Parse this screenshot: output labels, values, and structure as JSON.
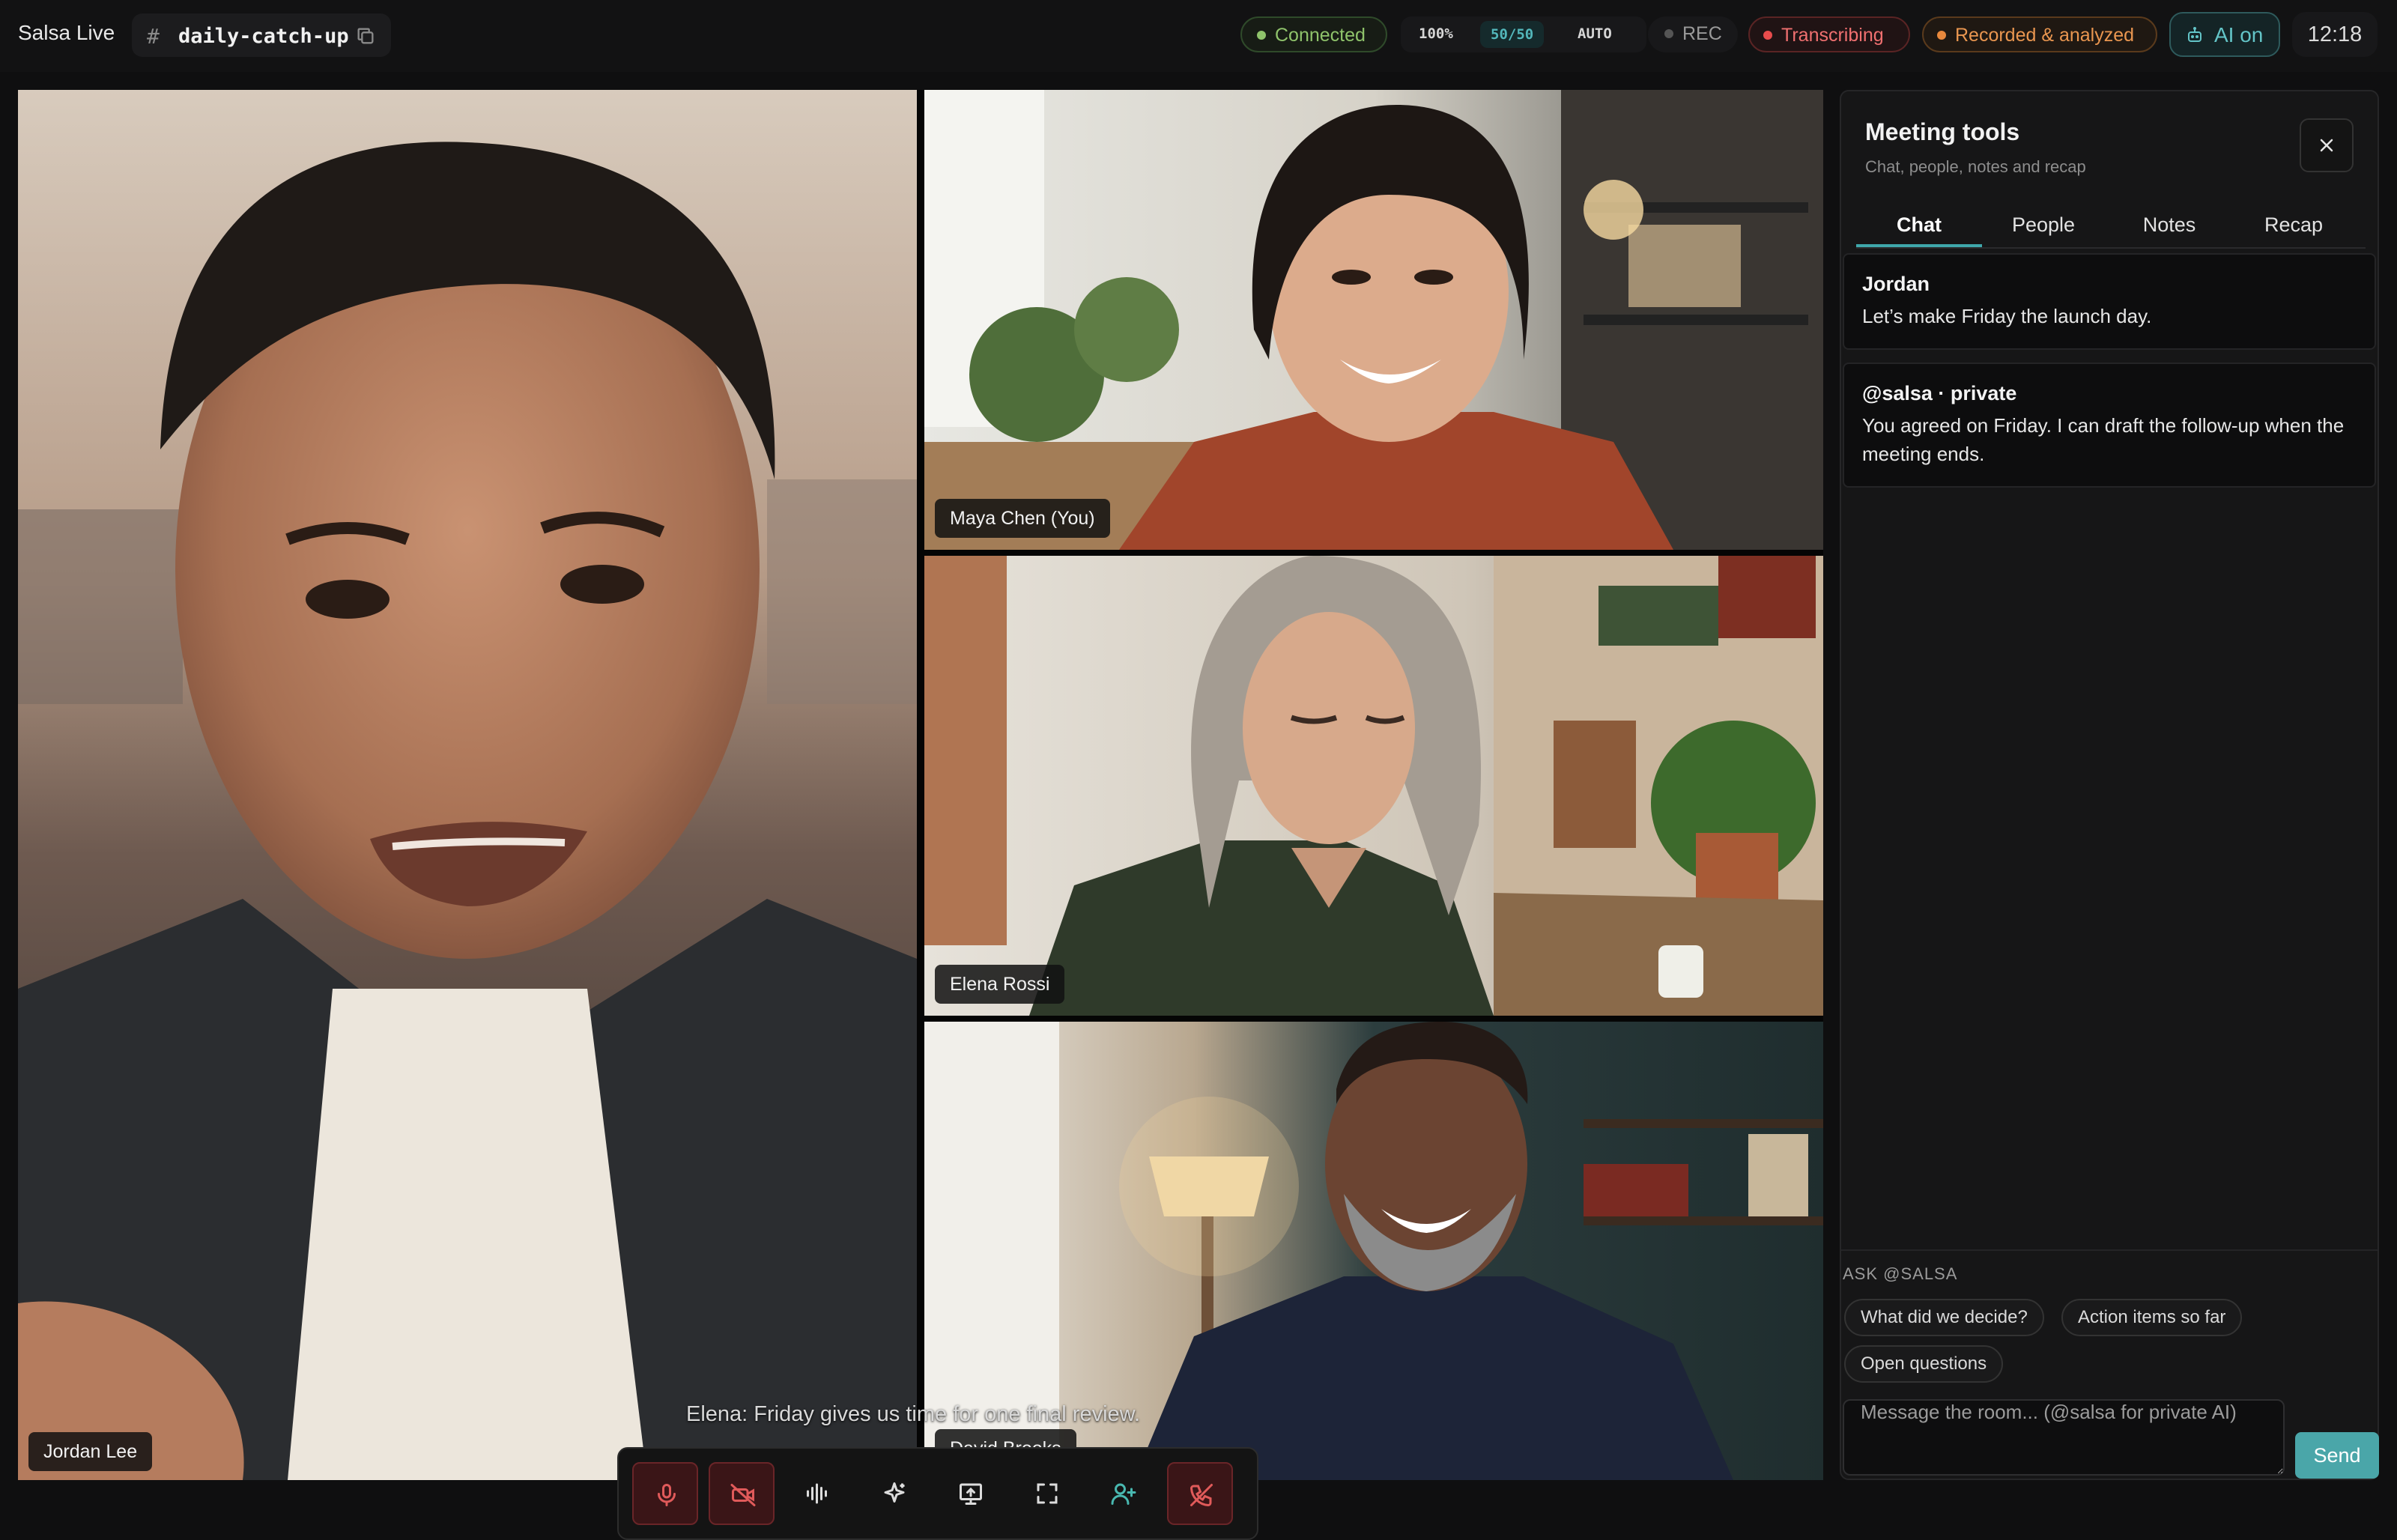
{
  "app": {
    "name": "Salsa Live"
  },
  "room": {
    "hash": "#",
    "name": "daily-catch-up"
  },
  "status": {
    "connected": "Connected",
    "quality": "100%",
    "split": "50/50",
    "mode": "AUTO",
    "rec": "REC",
    "transcribing": "Transcribing",
    "recorded": "Recorded & analyzed",
    "ai": "AI on",
    "clock": "12:18"
  },
  "colors": {
    "accent": "#4aa6a9",
    "connected": "#8fc36b",
    "transcribing": "#f07070",
    "recorded": "#e99650"
  },
  "participants": [
    {
      "name": "Jordan Lee"
    },
    {
      "name": "Maya Chen (You)"
    },
    {
      "name": "Elena Rossi"
    },
    {
      "name": "David Brooks"
    }
  ],
  "caption": "Elena: Friday gives us time for one final review.",
  "controls": [
    {
      "id": "mic",
      "icon": "microphone-icon"
    },
    {
      "id": "camera",
      "icon": "camera-off-icon"
    },
    {
      "id": "audio",
      "icon": "waveform-icon"
    },
    {
      "id": "ai",
      "icon": "sparkle-icon"
    },
    {
      "id": "share",
      "icon": "screen-share-icon"
    },
    {
      "id": "fullscreen",
      "icon": "fullscreen-icon"
    },
    {
      "id": "invite",
      "icon": "add-person-icon"
    },
    {
      "id": "leave",
      "icon": "hang-up-icon"
    }
  ],
  "panel": {
    "title": "Meeting tools",
    "subtitle": "Chat, people, notes and recap",
    "tabs": [
      {
        "label": "Chat",
        "active": true
      },
      {
        "label": "People",
        "active": false
      },
      {
        "label": "Notes",
        "active": false
      },
      {
        "label": "Recap",
        "active": false
      }
    ],
    "messages": [
      {
        "author": "Jordan",
        "text": "Let’s make Friday the launch day."
      },
      {
        "author": "@salsa · private",
        "text": "You agreed on Friday. I can draft the follow-up when the meeting ends."
      }
    ],
    "ask": {
      "label": "ASK @SALSA",
      "chips": [
        "What did we decide?",
        "Action items so far",
        "Open questions"
      ]
    },
    "input_placeholder": "Message the room... (@salsa for private AI)",
    "send_label": "Send"
  }
}
